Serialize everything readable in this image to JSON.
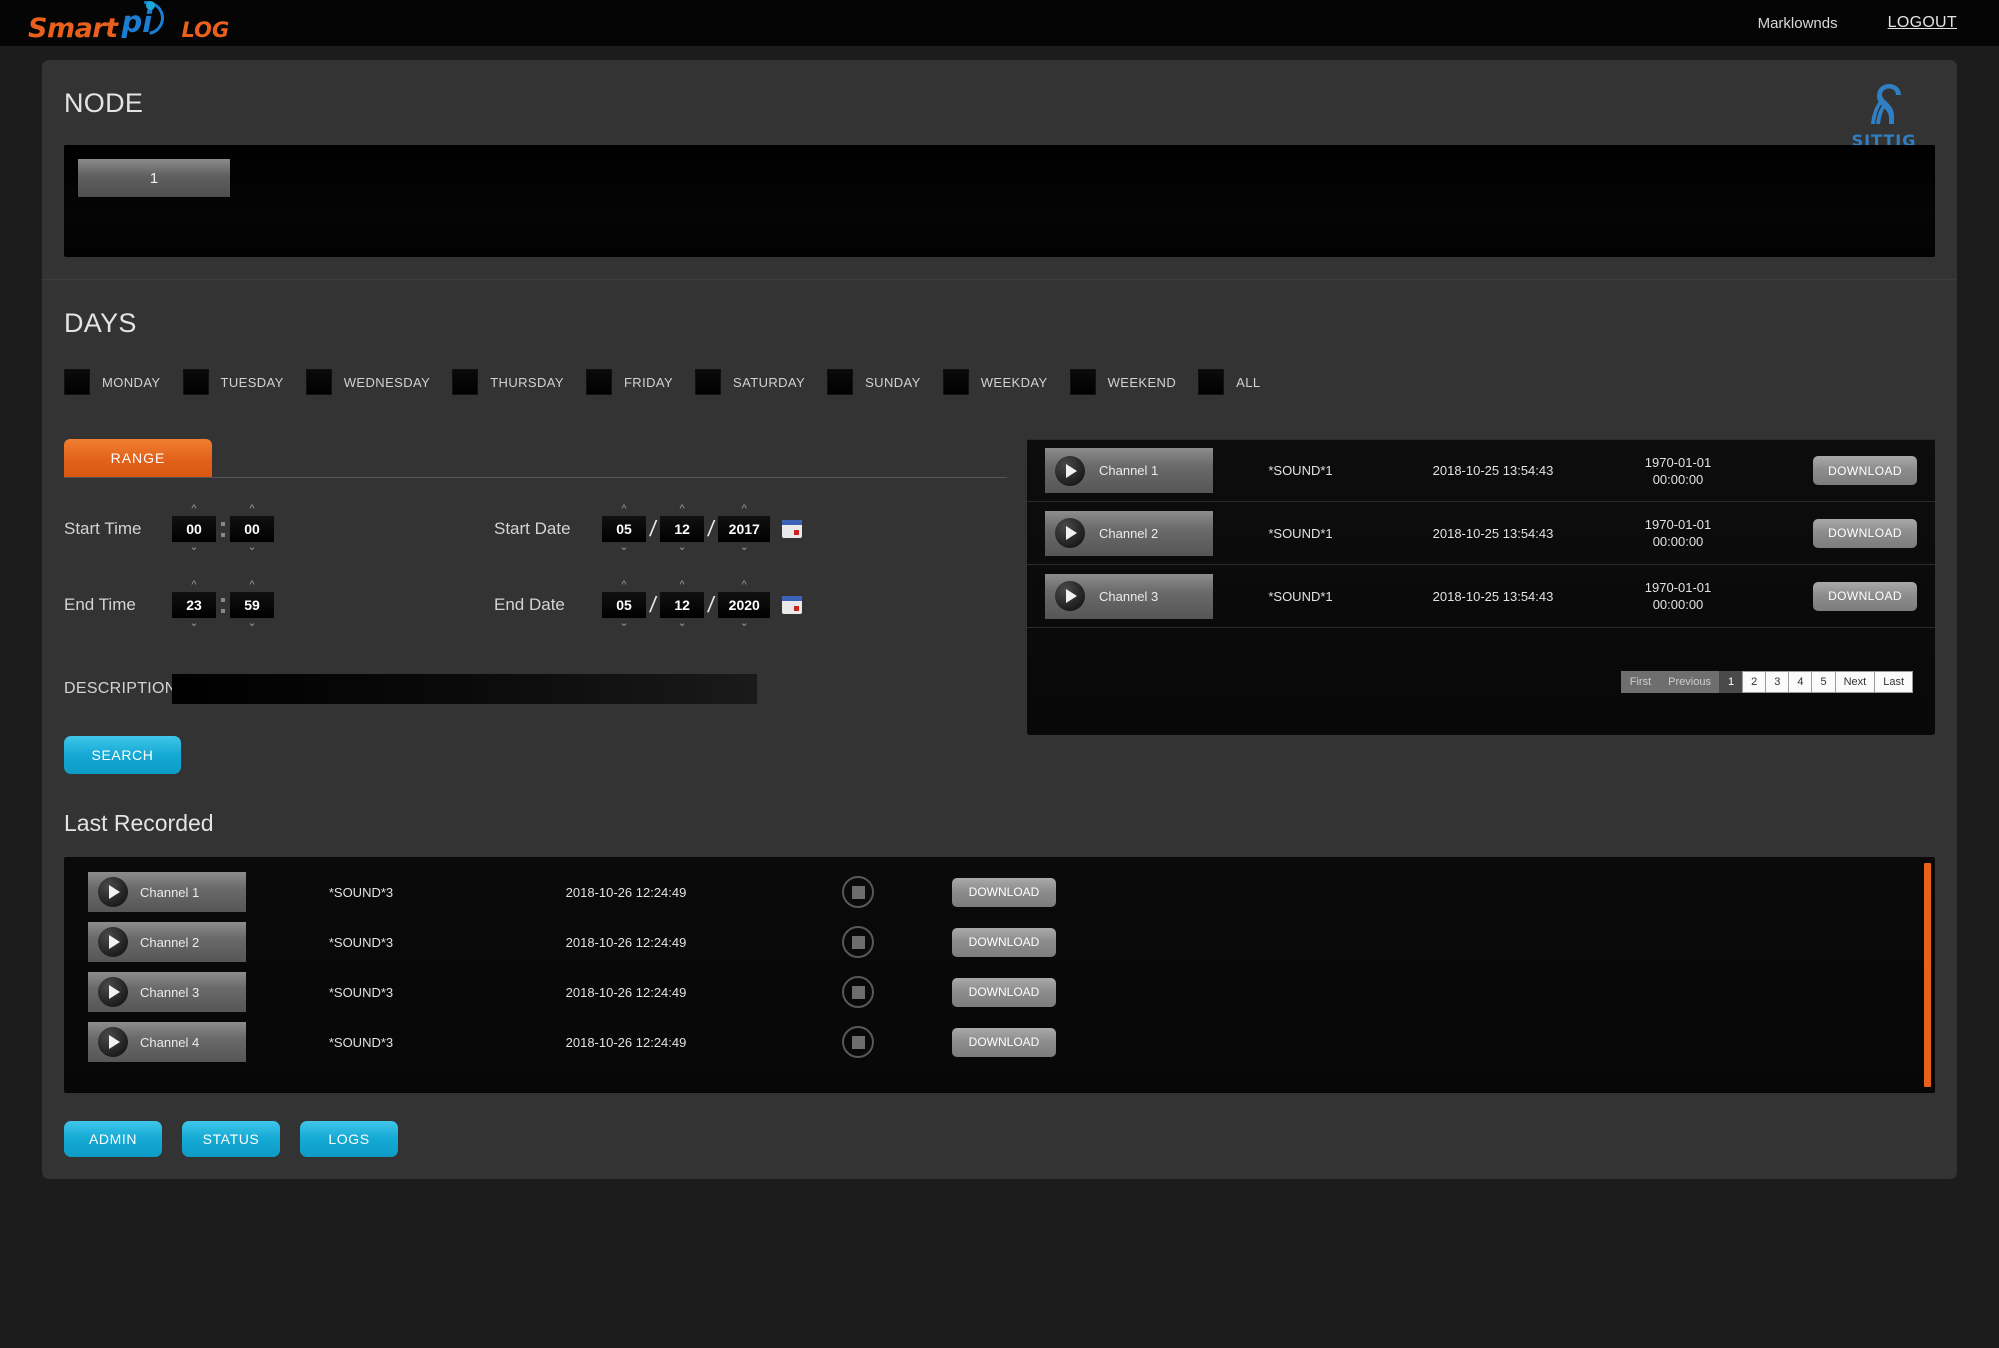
{
  "header": {
    "logo_smart": "Smart",
    "logo_pi": "pi",
    "logo_log": "LOG",
    "user": "Marklownds",
    "logout": "LOGOUT"
  },
  "node": {
    "title": "NODE",
    "buttons": [
      "1"
    ],
    "brand": "SITTIG"
  },
  "days": {
    "title": "DAYS",
    "items": [
      {
        "label": "MONDAY",
        "checked": false
      },
      {
        "label": "TUESDAY",
        "checked": false
      },
      {
        "label": "WEDNESDAY",
        "checked": false
      },
      {
        "label": "THURSDAY",
        "checked": false
      },
      {
        "label": "FRIDAY",
        "checked": false
      },
      {
        "label": "SATURDAY",
        "checked": false
      },
      {
        "label": "SUNDAY",
        "checked": false
      },
      {
        "label": "WEEKDAY",
        "checked": false
      },
      {
        "label": "WEEKEND",
        "checked": false
      },
      {
        "label": "ALL",
        "checked": false
      }
    ]
  },
  "search_form": {
    "tab_range": "RANGE",
    "start_time_label": "Start Time",
    "start_time_hour": "00",
    "start_time_min": "00",
    "end_time_label": "End Time",
    "end_time_hour": "23",
    "end_time_min": "59",
    "start_date_label": "Start Date",
    "start_date_day": "05",
    "start_date_month": "12",
    "start_date_year": "2017",
    "end_date_label": "End Date",
    "end_date_day": "05",
    "end_date_month": "12",
    "end_date_year": "2020",
    "description_label": "DESCRIPTION",
    "description_value": "",
    "description_placeholder": "",
    "search_label": "SEARCH"
  },
  "results": {
    "rows": [
      {
        "channel": "Channel 1",
        "sound": "*SOUND*1",
        "recorded": "2018-10-25 13:54:43",
        "epoch_date": "1970-01-01",
        "epoch_time": "00:00:00",
        "download": "DOWNLOAD"
      },
      {
        "channel": "Channel 2",
        "sound": "*SOUND*1",
        "recorded": "2018-10-25 13:54:43",
        "epoch_date": "1970-01-01",
        "epoch_time": "00:00:00",
        "download": "DOWNLOAD"
      },
      {
        "channel": "Channel 3",
        "sound": "*SOUND*1",
        "recorded": "2018-10-25 13:54:43",
        "epoch_date": "1970-01-01",
        "epoch_time": "00:00:00",
        "download": "DOWNLOAD"
      }
    ],
    "pager": [
      {
        "label": "First",
        "state": "muted"
      },
      {
        "label": "Previous",
        "state": "muted"
      },
      {
        "label": "1",
        "state": "active"
      },
      {
        "label": "2",
        "state": "normal"
      },
      {
        "label": "3",
        "state": "normal"
      },
      {
        "label": "4",
        "state": "normal"
      },
      {
        "label": "5",
        "state": "normal"
      },
      {
        "label": "Next",
        "state": "normal"
      },
      {
        "label": "Last",
        "state": "normal"
      }
    ]
  },
  "last_recorded": {
    "title": "Last Recorded",
    "rows": [
      {
        "channel": "Channel 1",
        "sound": "*SOUND*3",
        "recorded": "2018-10-26 12:24:49",
        "download": "DOWNLOAD"
      },
      {
        "channel": "Channel 2",
        "sound": "*SOUND*3",
        "recorded": "2018-10-26 12:24:49",
        "download": "DOWNLOAD"
      },
      {
        "channel": "Channel 3",
        "sound": "*SOUND*3",
        "recorded": "2018-10-26 12:24:49",
        "download": "DOWNLOAD"
      },
      {
        "channel": "Channel 4",
        "sound": "*SOUND*3",
        "recorded": "2018-10-26 12:24:49",
        "download": "DOWNLOAD"
      }
    ]
  },
  "footer": {
    "admin": "ADMIN",
    "status": "STATUS",
    "logs": "LOGS"
  },
  "colors": {
    "accent_orange": "#e8601c",
    "accent_cyan": "#14a9d4",
    "brand_blue": "#2f7fc4",
    "panel_bg": "#333333",
    "page_bg": "#1c1c1c"
  }
}
